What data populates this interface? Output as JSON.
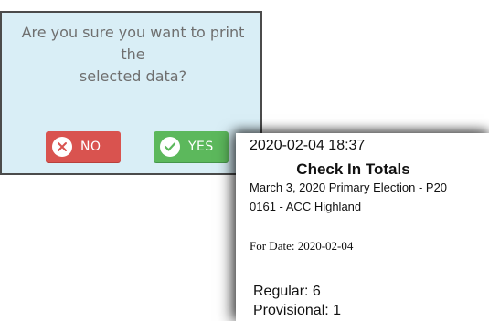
{
  "dialog": {
    "message_line1": "Are you sure you want to print the",
    "message_line2": "selected data?",
    "no_label": "NO",
    "yes_label": "YES",
    "no_icon": "x-circle-icon",
    "yes_icon": "check-circle-icon",
    "colors": {
      "background": "#d9eef6",
      "no": "#d9534f",
      "yes": "#5cb85c"
    }
  },
  "receipt": {
    "timestamp": "2020-02-04 18:37",
    "title": "Check In Totals",
    "election": "March 3, 2020 Primary Election - P20",
    "precinct": "0161 - ACC Highland",
    "for_date": "For Date: 2020-02-04",
    "regular": "Regular: 6",
    "provisional": "Provisional: 1"
  }
}
